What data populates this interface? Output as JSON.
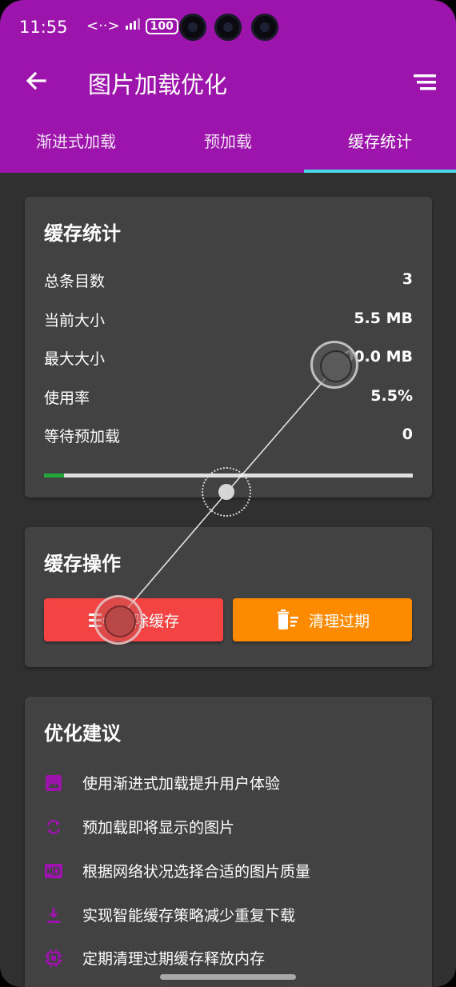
{
  "status_bar": {
    "time": "11:55",
    "battery": "100"
  },
  "app_bar": {
    "title": "图片加载优化"
  },
  "tabs": [
    {
      "label": "渐进式加载",
      "active": false
    },
    {
      "label": "预加载",
      "active": false
    },
    {
      "label": "缓存统计",
      "active": true
    }
  ],
  "stats_card": {
    "title": "缓存统计",
    "rows": [
      {
        "label": "总条目数",
        "value": "3"
      },
      {
        "label": "当前大小",
        "value": "5.5 MB"
      },
      {
        "label": "最大大小",
        "value": "100.0 MB"
      },
      {
        "label": "使用率",
        "value": "5.5%"
      },
      {
        "label": "等待预加载",
        "value": "0"
      }
    ],
    "usage_fraction": 0.055
  },
  "actions_card": {
    "title": "缓存操作",
    "clear_label": "清除缓存",
    "cleanup_label": "清理过期"
  },
  "suggestions_card": {
    "title": "优化建议",
    "items": [
      {
        "icon": "image-icon",
        "text": "使用渐进式加载提升用户体验"
      },
      {
        "icon": "sync-icon",
        "text": "预加载即将显示的图片"
      },
      {
        "icon": "hd-icon",
        "text": "根据网络状况选择合适的图片质量"
      },
      {
        "icon": "download-icon",
        "text": "实现智能缓存策略减少重复下载"
      },
      {
        "icon": "memory-icon",
        "text": "定期清理过期缓存释放内存"
      }
    ]
  },
  "colors": {
    "primary": "#9c14ac",
    "tab_indicator": "#4ad7e4",
    "danger": "#f44343",
    "warning": "#fe8a00",
    "progress": "#22a83c",
    "card": "#424242",
    "background": "#303030"
  }
}
